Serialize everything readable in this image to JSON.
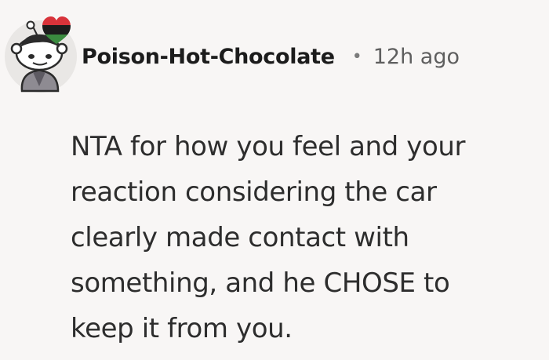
{
  "comment": {
    "author": "Poison-Hot-Chocolate",
    "separator": "•",
    "timestamp": "12h ago",
    "avatar_icon": "snoo-avatar-with-flag-heart-icon",
    "flair_colors": {
      "top": "#d8333a",
      "middle": "#1c1c1c",
      "bottom": "#3a8b3f"
    },
    "body_lines": [
      "NTA for how you feel and your",
      "reaction considering the car",
      "clearly made contact with",
      "something, and he CHOSE to",
      "keep it from you."
    ]
  }
}
